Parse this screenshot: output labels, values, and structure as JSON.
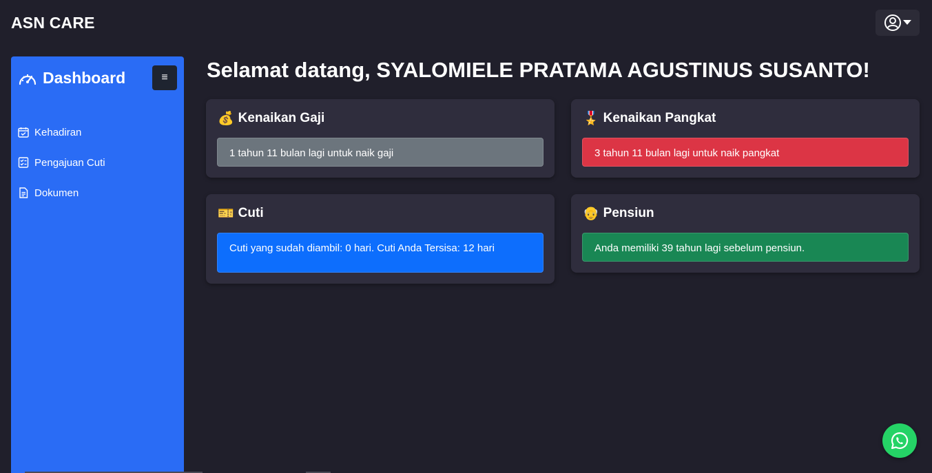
{
  "app": {
    "brand": "ASN CARE"
  },
  "header": {
    "user_menu_icon": "user-circle-icon",
    "caret_icon": "caret-down-icon"
  },
  "sidebar": {
    "title": "Dashboard",
    "title_icon": "speedometer-icon",
    "toggle_label": "≡",
    "items": [
      {
        "label": "Kehadiran",
        "icon": "calendar-check-icon"
      },
      {
        "label": "Pengajuan Cuti",
        "icon": "checklist-icon"
      },
      {
        "label": "Dokumen",
        "icon": "document-icon"
      }
    ],
    "bg_color": "#2a6cf5"
  },
  "main": {
    "heading": "Selamat datang, SYALOMIELE PRATAMA AGUSTINUS SUSANTO!",
    "cards": [
      {
        "emoji": "💰",
        "title": "Kenaikan Gaji",
        "message": "1 tahun 11 bulan lagi untuk naik gaji",
        "color": "#6c757d"
      },
      {
        "emoji": "🎖️",
        "title": "Kenaikan Pangkat",
        "message": "3 tahun 11 bulan lagi untuk naik pangkat",
        "color": "#dc3545"
      },
      {
        "emoji": "🎫",
        "title": "Cuti",
        "message": "Cuti yang sudah diambil: 0 hari. Cuti Anda Tersisa: 12 hari",
        "color": "#0d6efd"
      },
      {
        "emoji": "👴",
        "title": "Pensiun",
        "message": "Anda memiliki 39 tahun lagi sebelum pensiun.",
        "color": "#198754"
      }
    ]
  },
  "floating": {
    "whatsapp_icon": "whatsapp-icon",
    "color": "#25d366"
  }
}
